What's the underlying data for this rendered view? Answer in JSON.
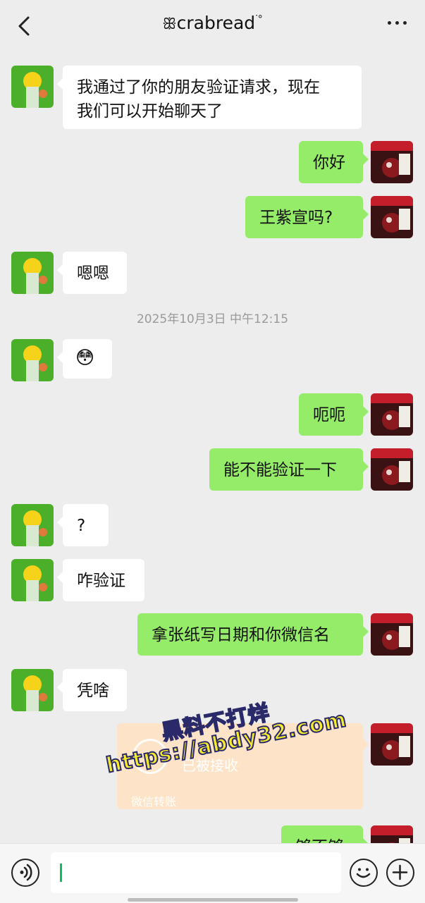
{
  "header": {
    "title": "crabread",
    "title_prefix": "ꕥ",
    "title_suffix": "ᐝ°"
  },
  "icons": {
    "back": "chevron-left-icon",
    "more": "more-dots-icon",
    "voice": "voice-icon",
    "emoji": "emoji-icon",
    "plus": "plus-icon"
  },
  "messages": [
    {
      "side": "in",
      "text": "我通过了你的朋友验证请求，现在\n我们可以开始聊天了"
    },
    {
      "side": "out",
      "text": "你好"
    },
    {
      "side": "out",
      "text": "王紫宣吗?"
    },
    {
      "side": "in",
      "text": "嗯嗯"
    },
    {
      "side": "in",
      "text": "😳"
    },
    {
      "side": "out",
      "text": "呃呃"
    },
    {
      "side": "out",
      "text": "能不能验证一下"
    },
    {
      "side": "in",
      "text": "?"
    },
    {
      "side": "in",
      "text": "咋验证"
    },
    {
      "side": "out",
      "text": "拿张纸写日期和你微信名"
    },
    {
      "side": "in",
      "text": "凭啥"
    },
    {
      "side": "out",
      "text": "够不够"
    }
  ],
  "timestamp": "2025年10月3日 中午12:15",
  "transfer": {
    "status": "已被接收",
    "footer": "微信转账"
  },
  "watermark": {
    "line1": "黑料不打烊",
    "line2": "https://abdy32.com"
  },
  "input": {
    "value": ""
  },
  "colors": {
    "background": "#ededed",
    "outgoing_bubble": "#95ec69",
    "incoming_bubble": "#ffffff",
    "transfer_bubble": "#fde3c7",
    "caret": "#07c160"
  }
}
